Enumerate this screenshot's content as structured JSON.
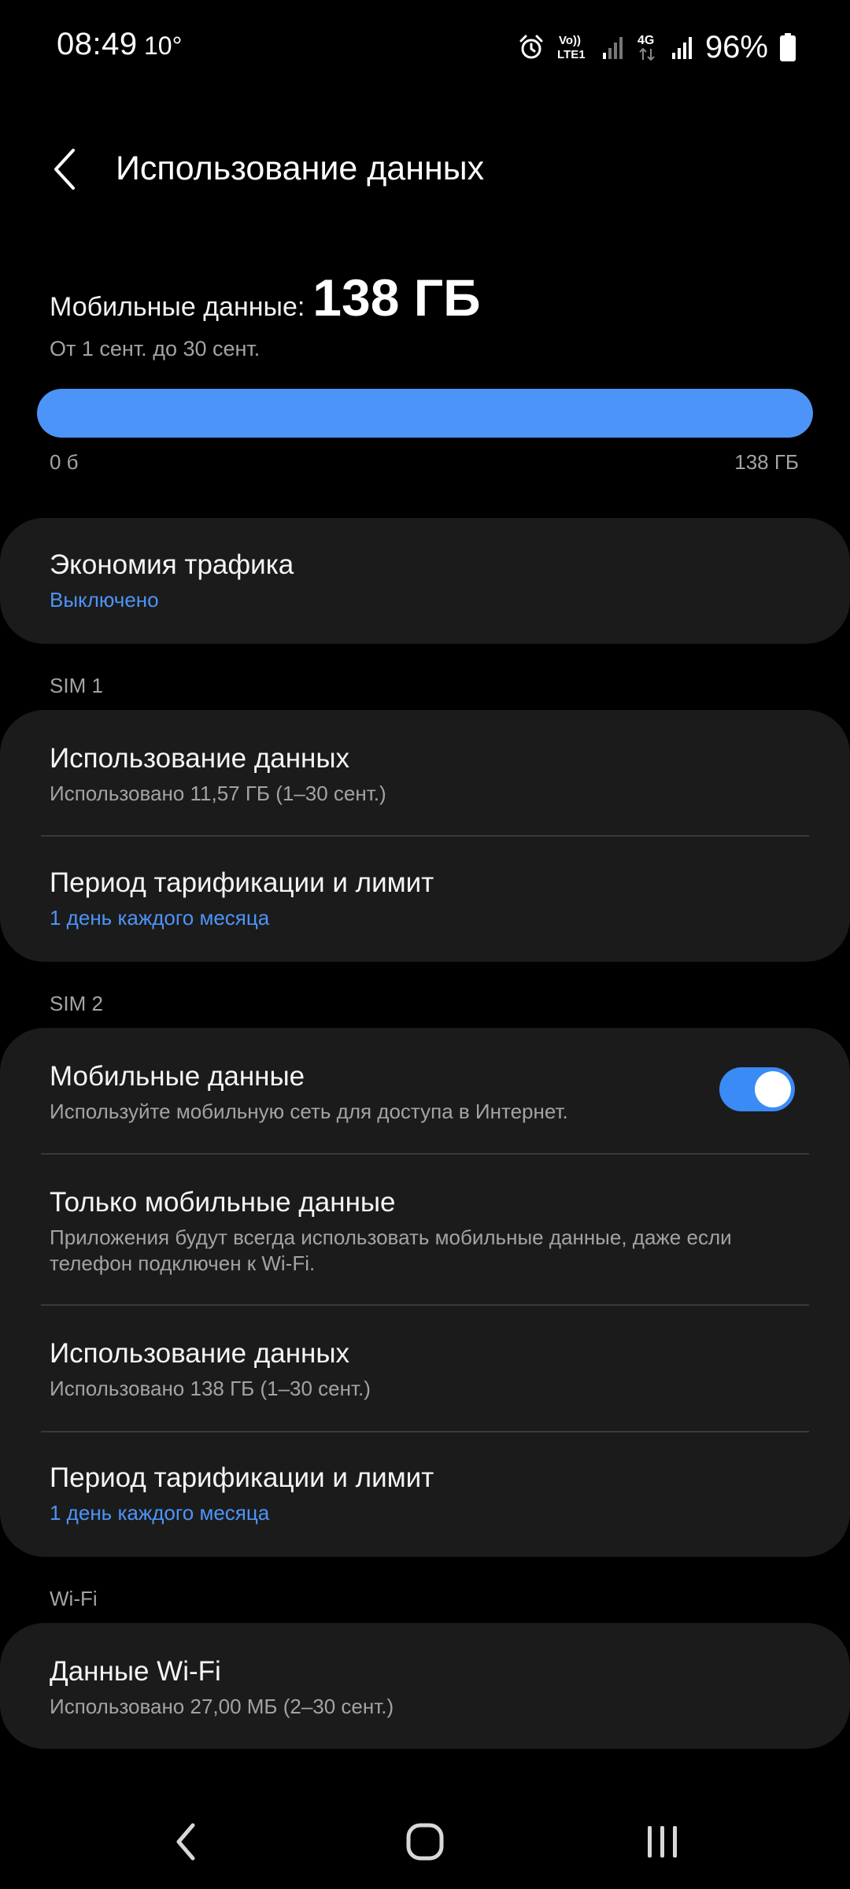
{
  "status_bar": {
    "time": "08:49",
    "temperature": "10°",
    "battery_percent": "96%",
    "icons": [
      "alarm-icon",
      "volte-lte1-icon",
      "signal-icon",
      "4g-data-icon",
      "signal-icon",
      "battery-icon"
    ],
    "volte_top": "Vo))",
    "volte_bottom": "LTE1",
    "net_label": "4G"
  },
  "app_bar": {
    "title": "Использование данных",
    "back_icon": "back-arrow-icon"
  },
  "usage_summary": {
    "label": "Мобильные данные:",
    "value": "138 ГБ",
    "period": "От 1 сент. до 30 сент.",
    "bar_min": "0 б",
    "bar_max": "138 ГБ",
    "bar_fill_fraction": 1.0,
    "bar_color": "#4d94f8"
  },
  "data_saver": {
    "title": "Экономия трафика",
    "status": "Выключено"
  },
  "sim1": {
    "header": "SIM 1",
    "usage_title": "Использование данных",
    "usage_sub": "Использовано 11,57 ГБ (1–30 сент.)",
    "billing_title": "Период тарификации и лимит",
    "billing_sub": "1 день каждого месяца"
  },
  "sim2": {
    "header": "SIM 2",
    "mobile_data_title": "Мобильные данные",
    "mobile_data_sub": "Используйте мобильную сеть для доступа в Интернет.",
    "mobile_data_enabled": true,
    "only_mobile_title": "Только мобильные данные",
    "only_mobile_sub": "Приложения будут всегда использовать мобильные данные, даже если телефон подключен к Wi-Fi.",
    "usage_title": "Использование данных",
    "usage_sub": "Использовано 138 ГБ (1–30 сент.)",
    "billing_title": "Период тарификации и лимит",
    "billing_sub": "1 день каждого месяца"
  },
  "wifi": {
    "header": "Wi-Fi",
    "title": "Данные Wi-Fi",
    "sub": "Использовано 27,00 МБ (2–30 сент.)"
  },
  "nav_bar": {
    "buttons": [
      "back-icon",
      "home-icon",
      "recents-icon"
    ]
  },
  "colors": {
    "background": "#000000",
    "card": "#1b1b1b",
    "accent": "#4d94f8",
    "secondary_text": "#a3a3a3"
  }
}
